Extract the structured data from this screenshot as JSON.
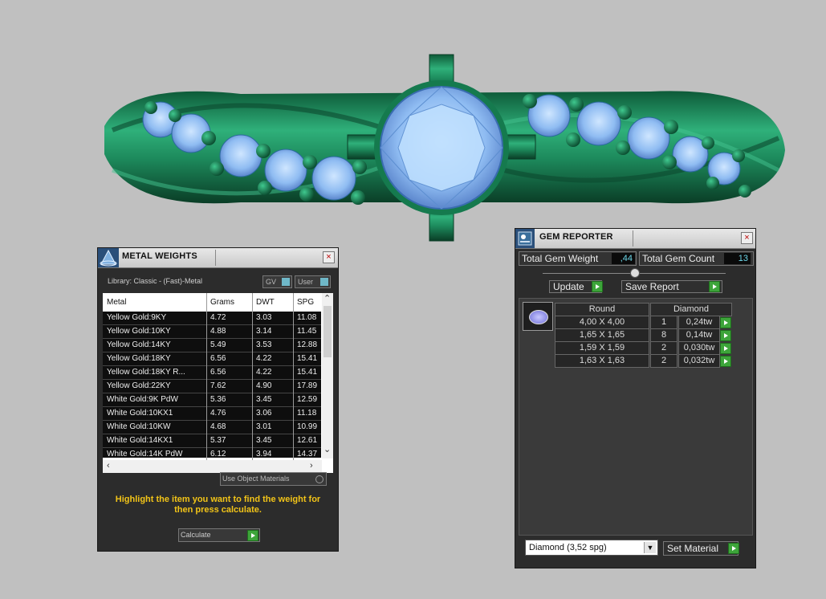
{
  "metal_weights": {
    "title": "METAL WEIGHTS",
    "close": "×",
    "library_label": "Library: Classic - (Fast)-Metal",
    "toggles": [
      "GV",
      "User"
    ],
    "columns": [
      "Metal",
      "Grams",
      "DWT",
      "SPG"
    ],
    "rows": [
      {
        "metal": "Yellow Gold:9KY",
        "grams": "4.72",
        "dwt": "3.03",
        "spg": "11.08"
      },
      {
        "metal": "Yellow Gold:10KY",
        "grams": "4.88",
        "dwt": "3.14",
        "spg": "11.45"
      },
      {
        "metal": "Yellow Gold:14KY",
        "grams": "5.49",
        "dwt": "3.53",
        "spg": "12.88"
      },
      {
        "metal": "Yellow Gold:18KY",
        "grams": "6.56",
        "dwt": "4.22",
        "spg": "15.41"
      },
      {
        "metal": "Yellow Gold:18KY R...",
        "grams": "6.56",
        "dwt": "4.22",
        "spg": "15.41"
      },
      {
        "metal": "Yellow Gold:22KY",
        "grams": "7.62",
        "dwt": "4.90",
        "spg": "17.89"
      },
      {
        "metal": "White Gold:9K PdW",
        "grams": "5.36",
        "dwt": "3.45",
        "spg": "12.59"
      },
      {
        "metal": "White Gold:10KX1",
        "grams": "4.76",
        "dwt": "3.06",
        "spg": "11.18"
      },
      {
        "metal": "White Gold:10KW",
        "grams": "4.68",
        "dwt": "3.01",
        "spg": "10.99"
      },
      {
        "metal": "White Gold:14KX1",
        "grams": "5.37",
        "dwt": "3.45",
        "spg": "12.61"
      },
      {
        "metal": "White Gold:14K PdW",
        "grams": "6.12",
        "dwt": "3.94",
        "spg": "14.37"
      }
    ],
    "use_object_materials": "Use Object Materials",
    "hint": "Highlight the item you want to find the weight for then press calculate.",
    "calculate": "Calculate"
  },
  "gem_reporter": {
    "title": "GEM REPORTER",
    "close": "×",
    "total_weight_label": "Total Gem Weight",
    "total_weight_value": ",44",
    "total_count_label": "Total Gem Count",
    "total_count_value": "13",
    "update": "Update",
    "save_report": "Save Report",
    "gem_shape": "Round",
    "gem_material": "Diamond",
    "gems": [
      {
        "size": "4,00 X 4,00",
        "count": "1",
        "weight": "0,24tw"
      },
      {
        "size": "1,65 X 1,65",
        "count": "8",
        "weight": "0,14tw"
      },
      {
        "size": "1,59 X 1,59",
        "count": "2",
        "weight": "0,030tw"
      },
      {
        "size": "1,63 X 1,63",
        "count": "2",
        "weight": "0,032tw"
      }
    ],
    "material_select": "Diamond     (3,52 spg)",
    "set_material": "Set Material"
  },
  "colors": {
    "metal": "#1f8e5e",
    "gem": "#9cc8ff",
    "accent": "#3da53a",
    "hint": "#f2c418"
  }
}
